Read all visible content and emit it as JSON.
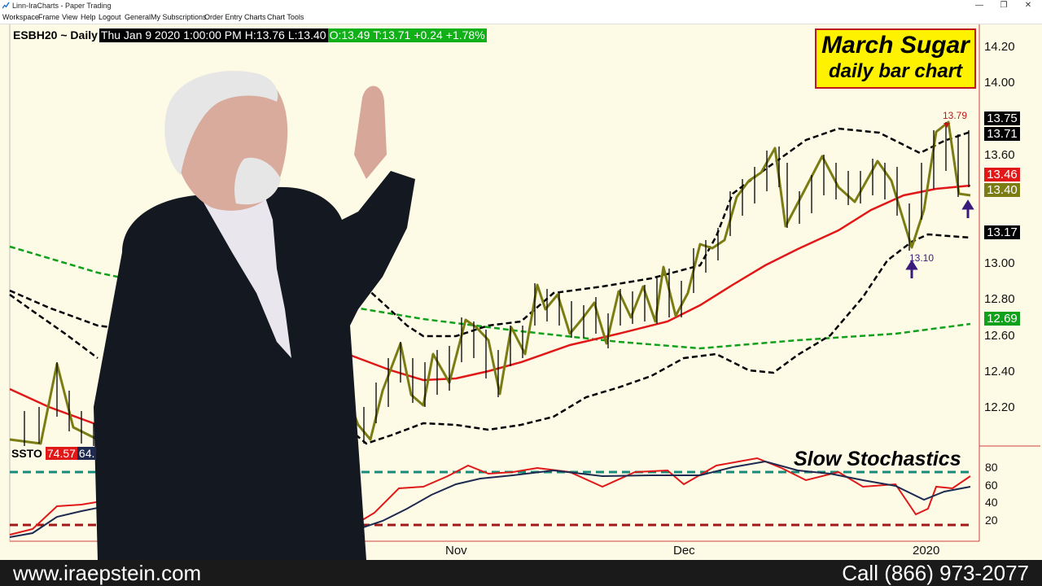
{
  "window": {
    "title": "Linn-IraCharts - Paper Trading",
    "controls": {
      "minimize": "—",
      "restore": "❐",
      "close": "✕"
    }
  },
  "menu": [
    "Workspace",
    "Frame",
    "View",
    "Help",
    "Logout",
    "General",
    "My Subscriptions",
    "Order Entry",
    "Charts",
    "Chart Tools"
  ],
  "infobar": {
    "symbol": "ESBH20 ~ Daily",
    "date": "Thu Jan 9 2020",
    "time": "1:00:00 PM",
    "high": "H:13.76",
    "low": "L:13.40",
    "open": "O:13.49",
    "last": "T:13.71",
    "change": "+0.24",
    "pct": "+1.78%"
  },
  "title_box": {
    "line1": "March Sugar",
    "line2": "daily bar chart"
  },
  "stochastics_title": "Slow Stochastics",
  "ssto": {
    "name": "SSTO",
    "v1": "74.57",
    "v2": "64."
  },
  "annotations": {
    "high": "13.79",
    "low": "13.10"
  },
  "price_axis": {
    "ticks": [
      "14.20",
      "14.00",
      "13.60",
      "13.00",
      "12.80",
      "12.60",
      "12.40",
      "12.20"
    ],
    "badges": [
      {
        "text": "13.75",
        "color": "#000000"
      },
      {
        "text": "13.71",
        "color": "#000000"
      },
      {
        "text": "13.46",
        "color": "#e01818"
      },
      {
        "text": "13.40",
        "color": "#7c7c14"
      },
      {
        "text": "13.17",
        "color": "#000000"
      },
      {
        "text": "12.69",
        "color": "#11a01b"
      }
    ]
  },
  "stoch_axis": {
    "ticks": [
      "80",
      "60",
      "40",
      "20"
    ]
  },
  "x_axis": {
    "labels": [
      "Nov",
      "Dec",
      "2020"
    ]
  },
  "footer": {
    "url": "www.iraepstein.com",
    "phone": "Call (866) 973-2077"
  },
  "colors": {
    "background": "#fdfbe6",
    "price_line": "#7c7c14",
    "ma_red": "#e01818",
    "ma_green": "#11a01b",
    "band": "#000000",
    "stoch_fast": "#e01818",
    "stoch_slow": "#1e2a50",
    "level_80": "#1a8a7a",
    "level_20": "#a01818"
  }
}
